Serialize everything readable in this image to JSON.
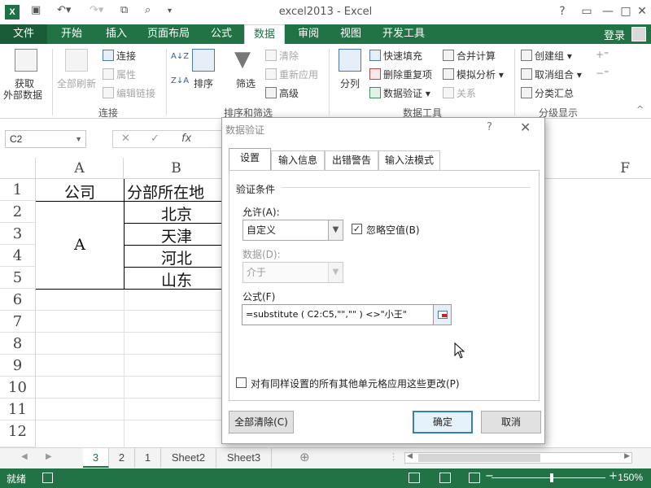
{
  "app": {
    "title": "excel2013 - Excel",
    "logo": "X",
    "qat_icons": [
      "save-icon",
      "undo-icon",
      "redo-icon",
      "copy-icon",
      "print-preview-icon",
      "customize-qat-icon"
    ],
    "window_controls": {
      "help": "?",
      "restore": "▭",
      "minimize": "—",
      "maximize": "□",
      "close": "✕"
    }
  },
  "ribbon_tabs": [
    "文件",
    "开始",
    "插入",
    "页面布局",
    "公式",
    "数据",
    "审阅",
    "视图",
    "开发工具"
  ],
  "active_tab": "数据",
  "login": "登录",
  "ribbon": {
    "get_external": {
      "line1": "获取",
      "line2": "外部数据"
    },
    "refresh_all": "全部刷新",
    "connections": {
      "conn": "连接",
      "props": "属性",
      "edit_links": "编辑链接",
      "label": "连接"
    },
    "sort_filter": {
      "sort_asc": "A↓Z",
      "sort_desc": "Z↓A",
      "sort": "排序",
      "filter": "筛选",
      "clear": "清除",
      "reapply": "重新应用",
      "advanced": "高级",
      "label": "排序和筛选"
    },
    "data_tools": {
      "text_to_cols": "分列",
      "flash_fill": "快速填充",
      "remove_dup": "删除重复项",
      "validation": "数据验证",
      "consolidate": "合并计算",
      "what_if": "模拟分析",
      "relations": "关系",
      "label": "数据工具"
    },
    "outline": {
      "group": "创建组",
      "ungroup": "取消组合",
      "subtotal": "分类汇总",
      "label": "分级显示"
    }
  },
  "formula_bar": {
    "name_box": "C2",
    "cancel": "✕",
    "enter": "✓",
    "fx": "fx"
  },
  "sheet": {
    "columns": [
      "A",
      "B",
      "F"
    ],
    "rows": [
      "1",
      "2",
      "3",
      "4",
      "5",
      "6",
      "7",
      "8",
      "9",
      "10",
      "11",
      "12"
    ],
    "cells": {
      "A1": "公司",
      "B1": "分部所在地",
      "A2": "A",
      "B2": "北京",
      "B3": "天津",
      "B4": "河北",
      "B5": "山东"
    }
  },
  "sheet_tabs": [
    "3",
    "2",
    "1",
    "Sheet2",
    "Sheet3"
  ],
  "active_sheet": "3",
  "status": {
    "ready": "就绪",
    "zoom": "150%"
  },
  "dialog": {
    "title": "数据验证",
    "help": "?",
    "close": "✕",
    "tabs": [
      "设置",
      "输入信息",
      "出错警告",
      "输入法模式"
    ],
    "active_tab": "设置",
    "section_title": "验证条件",
    "allow_label": "允许(A):",
    "allow_value": "自定义",
    "ignore_blank": "忽略空值(B)",
    "ignore_blank_checked": true,
    "data_label": "数据(D):",
    "data_value": "介于",
    "formula_label": "公式(F)",
    "formula_value": "=substitute ( C2:C5,\"\",\"\" ) <>\"小王\"",
    "apply_all": "对有同样设置的所有其他单元格应用这些更改(P)",
    "clear_all": "全部清除(C)",
    "ok": "确定",
    "cancel": "取消"
  }
}
